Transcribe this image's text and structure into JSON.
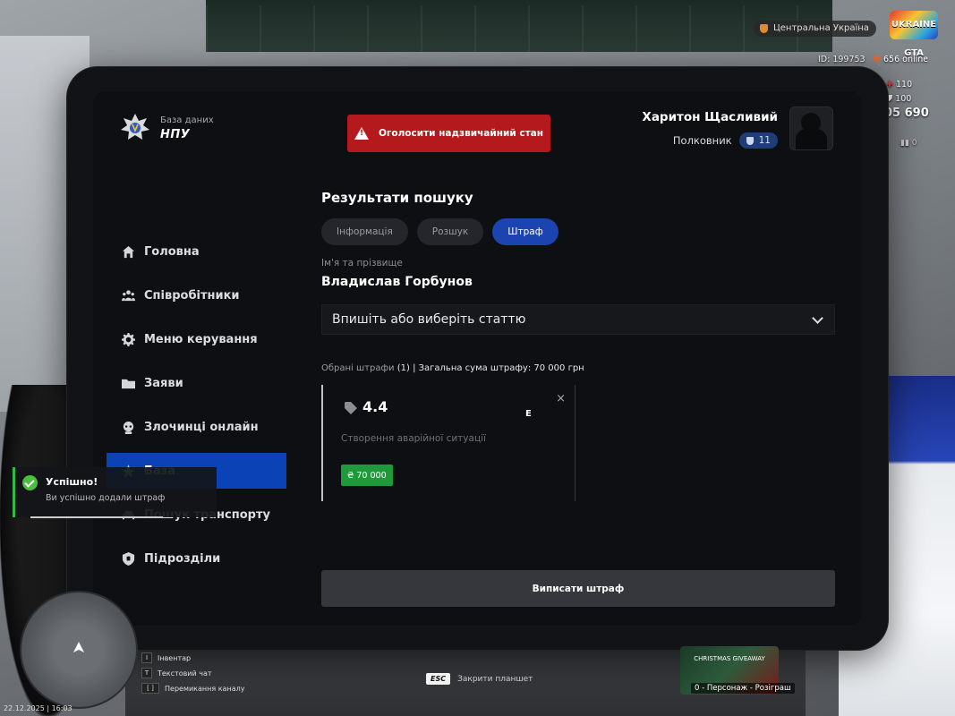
{
  "hud": {
    "server": "Центральна Україна",
    "logo": "UKRAINE GTA",
    "player_id": "ID: 199753",
    "online": "656 online",
    "health": "110",
    "armor": "100",
    "money": "05 690",
    "wanted": "0",
    "datetime": "22.12.2025 | 16:03",
    "keys": [
      {
        "key": "I",
        "label": "Інвентар"
      },
      {
        "key": "T",
        "label": "Текстовий чат"
      },
      {
        "key": "[ ]",
        "label": "Перемикання каналу"
      }
    ],
    "esc_key": "ESC",
    "esc_label": "Закрити планшет",
    "promo": "CHRISTMAS GIVEAWAY",
    "promo_caption": "0 - Персонаж - Розіграш"
  },
  "brand": {
    "subtitle": "База даних",
    "title": "НПУ"
  },
  "emergency_button": "Оголосити надзвичайний стан",
  "user": {
    "name": "Харитон Щасливий",
    "rank": "Полковник",
    "level": "11"
  },
  "nav": [
    {
      "label": "Головна",
      "icon": "home-icon"
    },
    {
      "label": "Співробітники",
      "icon": "people-icon"
    },
    {
      "label": "Меню керування",
      "icon": "gear-icon"
    },
    {
      "label": "Заяви",
      "icon": "folder-icon"
    },
    {
      "label": "Злочинці онлайн",
      "icon": "criminal-icon"
    },
    {
      "label": "База",
      "icon": "star-icon",
      "active": true
    },
    {
      "label": "Пошук транспорту",
      "icon": "car-icon"
    },
    {
      "label": "Підрозділи",
      "icon": "shield-icon"
    }
  ],
  "main": {
    "title": "Результати пошуку",
    "tabs": [
      "Інформація",
      "Розшук",
      "Штраф"
    ],
    "active_tab": "Штраф",
    "name_label": "Ім'я та прізвище",
    "name_value": "Владислав Горбунов",
    "select_placeholder": "Впишіть або виберіть статтю",
    "summary_prefix": "Обрані штрафи",
    "summary_count": "(1)",
    "summary_rest": "| Загальна сума штрафу: 70 000 грн",
    "fine": {
      "code": "4.4",
      "description": "Створення аварійної ситуації",
      "amount": "₴ 70 000",
      "close": "×"
    },
    "cursor_letter": "E",
    "issue_button": "Виписати штраф"
  },
  "toast": {
    "title": "Успішно!",
    "message": "Ви успішно додали штраф"
  },
  "colors": {
    "accent": "#0b43b6",
    "danger": "#b4191e",
    "success": "#1e9a3a"
  }
}
